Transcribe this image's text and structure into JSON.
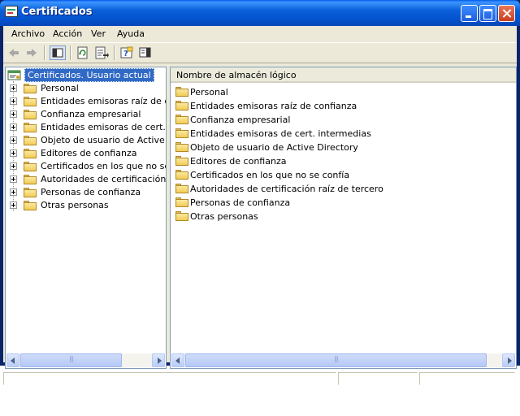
{
  "window": {
    "title": "Certificados",
    "title_icon": "certificate-console-icon"
  },
  "menubar": [
    "Archivo",
    "Acción",
    "Ver",
    "Ayuda"
  ],
  "toolbar": {
    "buttons": [
      "back-arrow-icon",
      "forward-arrow-icon",
      "show-hide-tree-icon",
      "refresh-icon",
      "export-list-icon",
      "help-icon",
      "show-action-pane-icon"
    ]
  },
  "tree": {
    "root": "Certificados. Usuario actual",
    "items": [
      "Personal",
      "Entidades emisoras raíz de confi",
      "Confianza empresarial",
      "Entidades emisoras de cert. inte",
      "Objeto de usuario de Active Direc",
      "Editores de confianza",
      "Certificados en los que no se co",
      "Autoridades de certificación raíz",
      "Personas de confianza",
      "Otras personas"
    ]
  },
  "list": {
    "column_header": "Nombre de almacén lógico",
    "items": [
      "Personal",
      "Entidades emisoras raíz de confianza",
      "Confianza empresarial",
      "Entidades emisoras de cert. intermedias",
      "Objeto de usuario de Active Directory",
      "Editores de confianza",
      "Certificados en los que no se confía",
      "Autoridades de certificación raíz de tercero",
      "Personas de confianza",
      "Otras personas"
    ]
  },
  "colors": {
    "titlebar": "#0554d0",
    "selection": "#316ac5",
    "chrome": "#ece9d8",
    "folder": "#f2cc55"
  }
}
